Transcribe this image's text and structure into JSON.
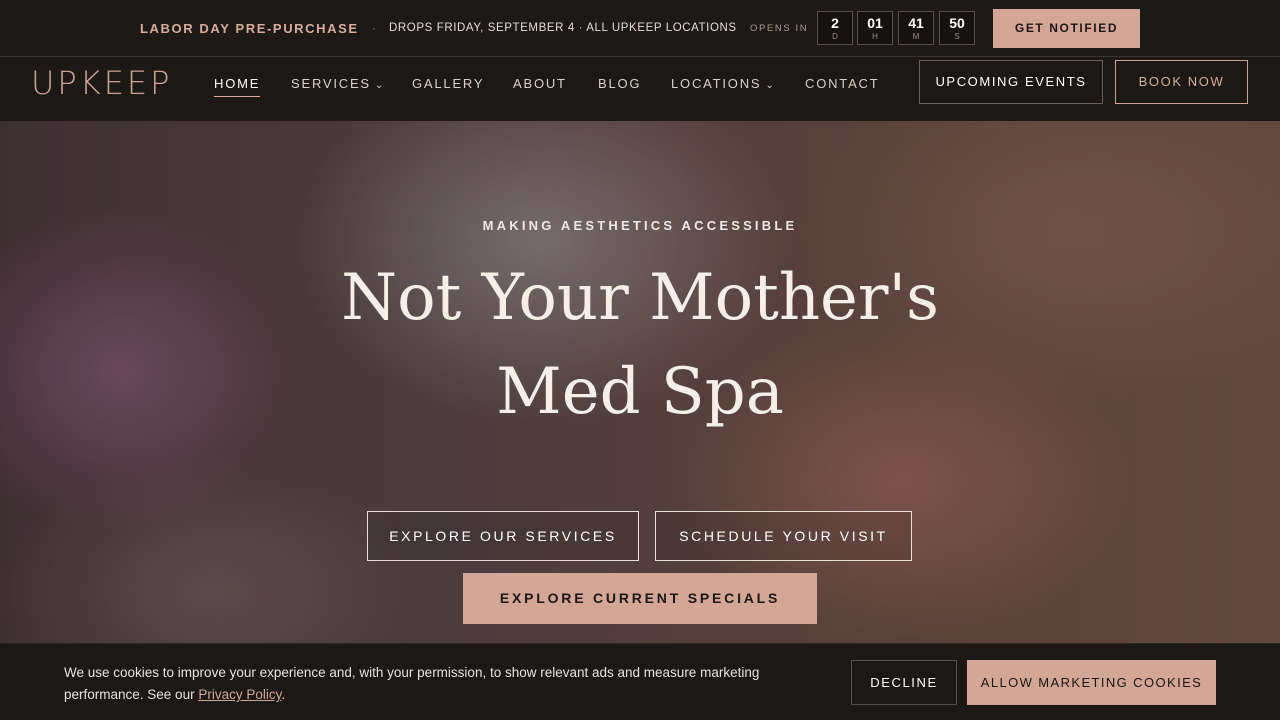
{
  "promo": {
    "title": "LABOR DAY PRE-PURCHASE",
    "separator": "·",
    "info": "DROPS FRIDAY, SEPTEMBER 4 · ALL UPKEEP LOCATIONS",
    "opens_label": "OPENS IN",
    "countdown": [
      {
        "value": "2",
        "unit": "D"
      },
      {
        "value": "01",
        "unit": "H"
      },
      {
        "value": "41",
        "unit": "M"
      },
      {
        "value": "50",
        "unit": "S"
      }
    ],
    "notify_label": "GET NOTIFIED"
  },
  "nav": {
    "logo": "UPKEEP",
    "items": [
      {
        "label": "HOME",
        "active": true
      },
      {
        "label": "SERVICES",
        "dropdown": true
      },
      {
        "label": "GALLERY"
      },
      {
        "label": "ABOUT"
      },
      {
        "label": "BLOG"
      },
      {
        "label": "LOCATIONS",
        "dropdown": true
      },
      {
        "label": "CONTACT"
      }
    ],
    "events_label": "UPCOMING EVENTS",
    "book_label": "BOOK NOW"
  },
  "hero": {
    "eyebrow": "MAKING AESTHETICS ACCESSIBLE",
    "headline_line1": "Not Your Mother's",
    "headline_line2": "Med Spa",
    "explore_services": "EXPLORE OUR SERVICES",
    "schedule_visit": "SCHEDULE YOUR VISIT",
    "specials": "EXPLORE CURRENT SPECIALS"
  },
  "cookie": {
    "text_before": "We use cookies to improve your experience and, with your permission, to show relevant ads and measure marketing performance. See our ",
    "link": "Privacy Policy",
    "text_after": ".",
    "decline": "DECLINE",
    "allow": "ALLOW MARKETING COOKIES"
  },
  "colors": {
    "accent": "#d2a795",
    "background": "#1c1816"
  }
}
